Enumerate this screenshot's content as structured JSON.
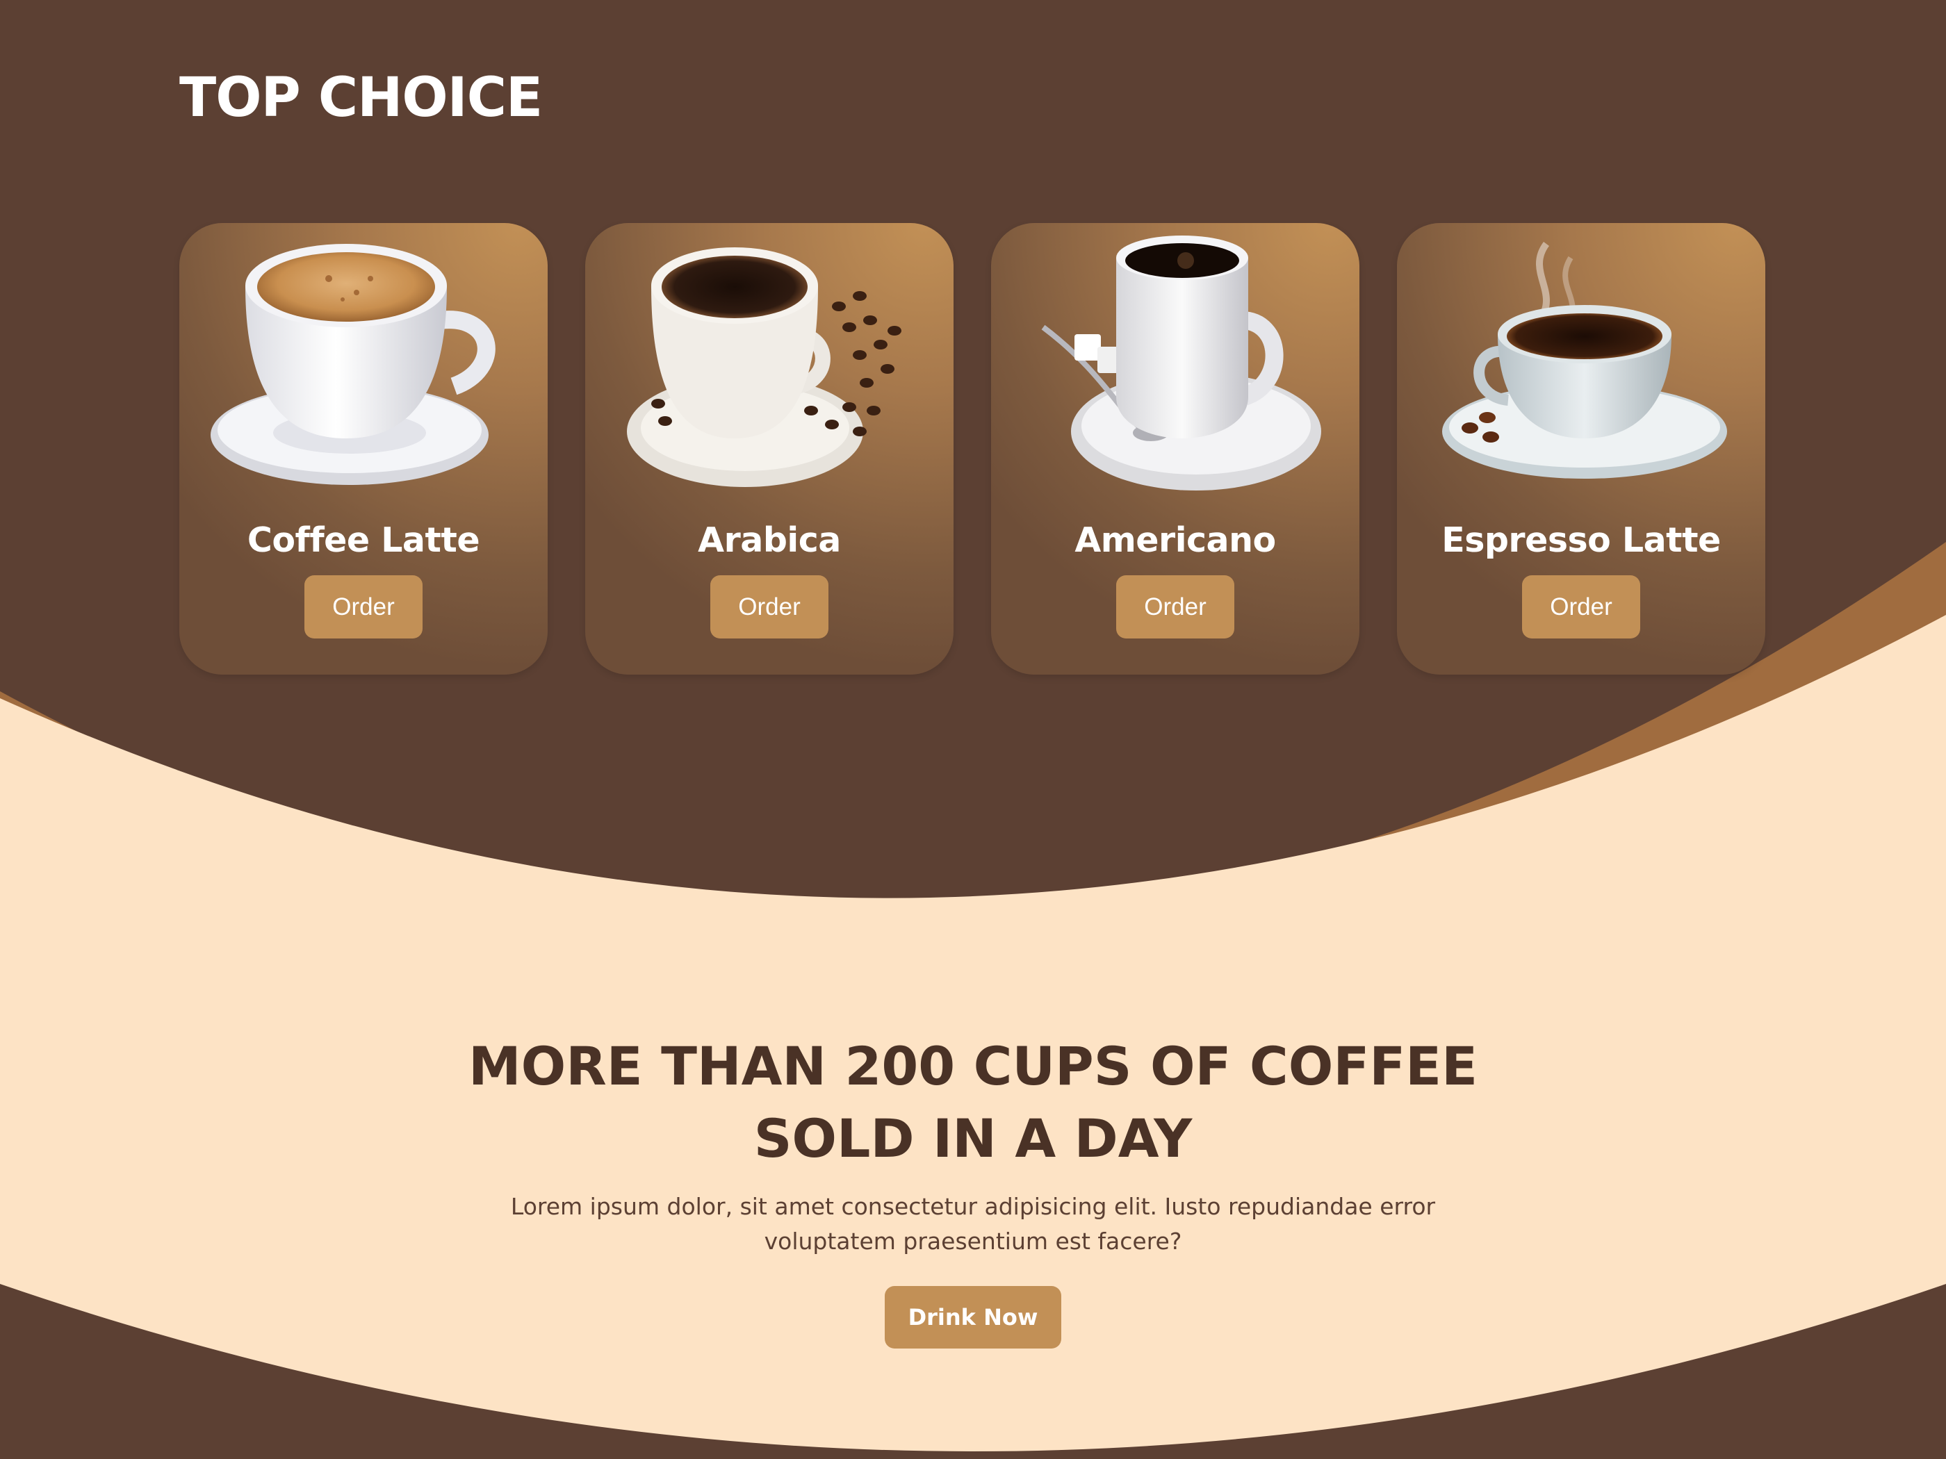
{
  "top_choice": {
    "title": "TOP CHOICE",
    "cards": [
      {
        "name": "Coffee Latte",
        "button": "Order"
      },
      {
        "name": "Arabica",
        "button": "Order"
      },
      {
        "name": "Americano",
        "button": "Order"
      },
      {
        "name": "Espresso Latte",
        "button": "Order"
      }
    ]
  },
  "promo": {
    "title_line1": "MORE THAN 200 CUPS OF COFFEE",
    "title_line2": "SOLD IN A DAY",
    "text_line1": "Lorem ipsum dolor, sit amet consectetur adipisicing elit. Iusto repudiandae error",
    "text_line2": "voluptatem praesentium est facere?",
    "button": "Drink Now"
  },
  "colors": {
    "background_dark": "#5c4033",
    "accent": "#c29056",
    "wave_band": "#a06c3f",
    "cream": "#fde3c5",
    "heading_dark": "#4a3226"
  }
}
